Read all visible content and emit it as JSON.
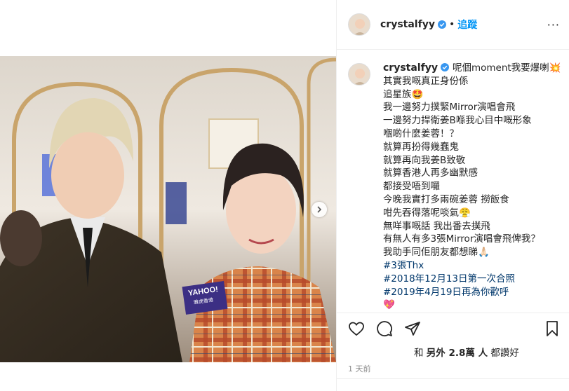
{
  "post": {
    "username": "crystalfyy",
    "follow_label": "追蹤",
    "separator": "•",
    "more_label": "···"
  },
  "caption": {
    "username": "crystalfyy",
    "lines": [
      "呢個moment我要爆喇💥",
      "其實我嘅真正身份係",
      "追星族🤩",
      "我一邊努力撲緊Mirror演唱會飛",
      "一邊努力捍衛姜B喺我心目中嘅形象",
      "嗰啲什麼姜蓉！？",
      "就算再扮得幾蠢鬼",
      "就算再向我姜B致敬",
      "就算香港人再多幽默感",
      "都接受唔到囉",
      "今晚我實打多兩碗姜蓉 撈飯食",
      "咁先吞得落呢啖氣😤",
      "無咩事嘅話 我出番去撲飛",
      "有無人有多3張Mirror演唱會飛俾我？",
      "我助手同佢朋友都想睇🙏🏻"
    ],
    "hashtags": [
      "#3張Thx",
      "#2018年12月13日第一次合照",
      "#2019年4月19日再為你歡呼"
    ],
    "ending_emoji": "💖"
  },
  "engagement": {
    "likes_prefix": "和",
    "likes_count": "另外 2.8萬 人",
    "likes_suffix": "都讚好",
    "time_ago": "1 天前"
  },
  "photo": {
    "badge_text": "YAHOO!",
    "badge_sub": "雅虎香港"
  },
  "icons": {
    "like": "heart-icon",
    "comment": "comment-icon",
    "share": "share-icon",
    "save": "bookmark-icon",
    "next": "chevron-right-icon",
    "verified": "verified-badge-icon"
  },
  "colors": {
    "link": "#0095f6",
    "hashtag": "#00376b",
    "verified": "#3897f0",
    "muted": "#8e8e8e"
  }
}
